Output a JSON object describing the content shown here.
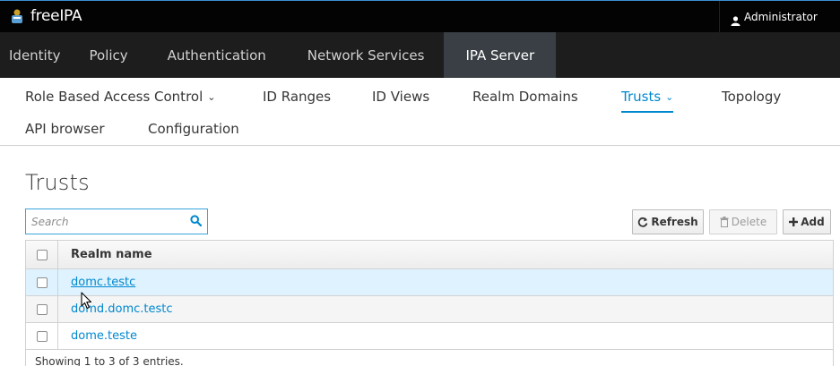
{
  "app": {
    "brand": "freeIPA",
    "user": "Administrator"
  },
  "primary_nav": [
    {
      "label": "Identity",
      "active": false
    },
    {
      "label": "Policy",
      "active": false
    },
    {
      "label": "Authentication",
      "active": false
    },
    {
      "label": "Network Services",
      "active": false
    },
    {
      "label": "IPA Server",
      "active": true
    }
  ],
  "secondary_nav": [
    {
      "label": "Role Based Access Control",
      "dropdown": true,
      "active": false
    },
    {
      "label": "ID Ranges",
      "dropdown": false,
      "active": false
    },
    {
      "label": "ID Views",
      "dropdown": false,
      "active": false
    },
    {
      "label": "Realm Domains",
      "dropdown": false,
      "active": false
    },
    {
      "label": "Trusts",
      "dropdown": true,
      "active": true
    },
    {
      "label": "Topology",
      "dropdown": false,
      "active": false
    },
    {
      "label": "API browser",
      "dropdown": false,
      "active": false
    },
    {
      "label": "Configuration",
      "dropdown": false,
      "active": false
    }
  ],
  "page": {
    "title": "Trusts"
  },
  "search": {
    "placeholder": "Search",
    "value": ""
  },
  "actions": {
    "refresh": "Refresh",
    "delete": "Delete",
    "add": "Add"
  },
  "table": {
    "columns": [
      "Realm name"
    ],
    "rows": [
      {
        "realm": "domc.testc",
        "selected": true
      },
      {
        "realm": "domd.domc.testc",
        "selected": false
      },
      {
        "realm": "dome.teste",
        "selected": false
      }
    ],
    "footer": "Showing 1 to 3 of 3 entries."
  },
  "colors": {
    "accent": "#0088ce",
    "topbar": "#030303",
    "nav": "#1d1d1d",
    "nav_active": "#393f44",
    "row_selected": "#def3ff"
  }
}
